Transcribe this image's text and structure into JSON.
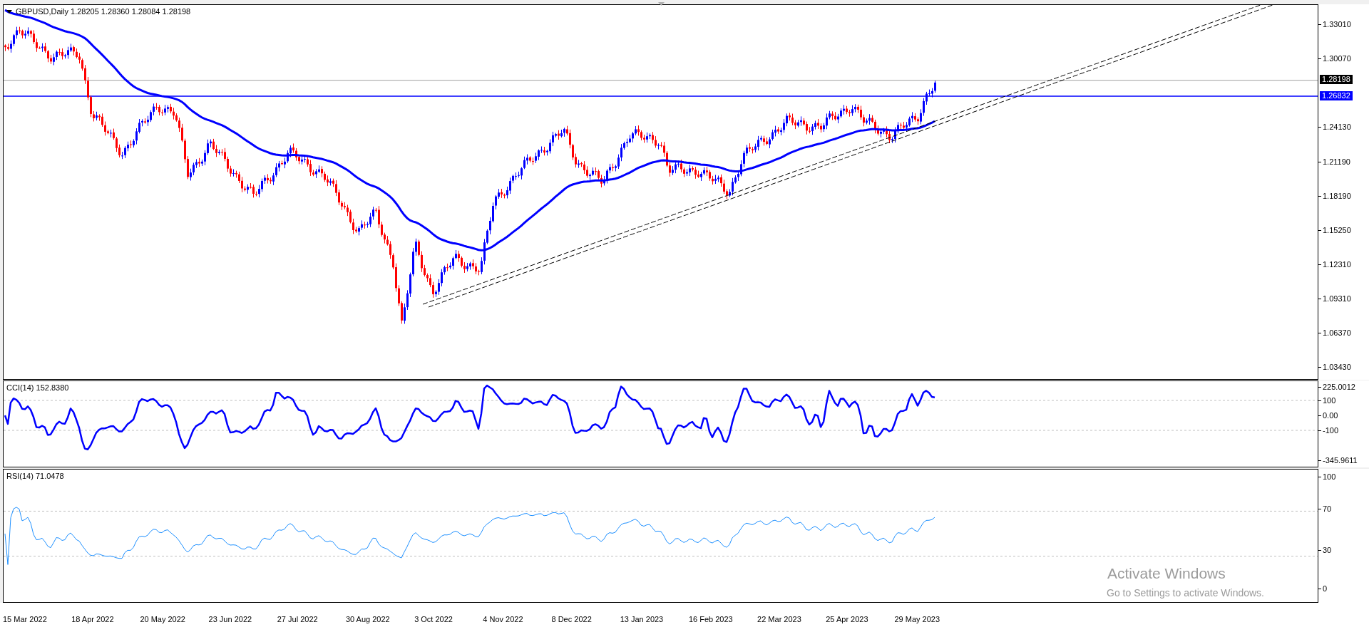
{
  "chart": {
    "title": "GBPUSD,Daily 1.28205 1.28360 1.28084 1.28198",
    "price_axis": [
      "1.33010",
      "1.30070",
      "1.24130",
      "1.21190",
      "1.18190",
      "1.15250",
      "1.12310",
      "1.09310",
      "1.06370",
      "1.03430"
    ],
    "current_price_tag": "1.28198",
    "line_price_tag": "1.26832"
  },
  "cci_panel": {
    "title": "CCI(14) 152.8380",
    "axis": [
      "225.0012",
      "100",
      "0.00",
      "-100",
      "-345.9611"
    ]
  },
  "rsi_panel": {
    "title": "RSI(14) 71.0478",
    "axis": [
      "100",
      "70",
      "30",
      "0"
    ]
  },
  "time_axis": [
    "15 Mar 2022",
    "18 Apr 2022",
    "20 May 2022",
    "23 Jun 2022",
    "27 Jul 2022",
    "30 Aug 2022",
    "3 Oct 2022",
    "4 Nov 2022",
    "8 Dec 2022",
    "13 Jan 2023",
    "16 Feb 2023",
    "22 Mar 2023",
    "25 Apr 2023",
    "29 May 2023"
  ],
  "windows_activation": {
    "title": "Activate Windows",
    "subtitle": "Go to Settings to activate Windows."
  }
}
